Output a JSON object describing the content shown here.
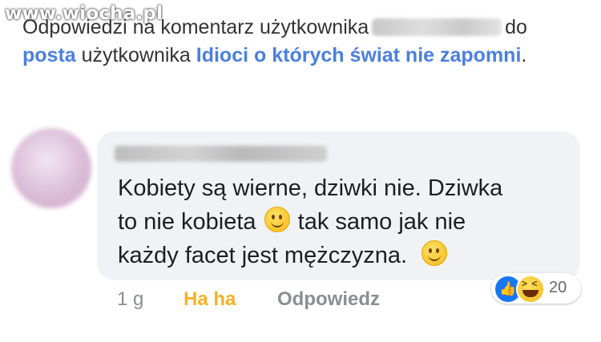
{
  "watermark": "www.wiocha.pl",
  "header": {
    "prefix": "Odpowiedzi na komentarz użytkownika",
    "suffix_after_name": "do",
    "post_link": "posta",
    "middle": "użytkownika",
    "page_link": "Idioci o których świat nie zapomni",
    "end": "."
  },
  "comment": {
    "line1": "Kobiety są wierne,  dziwki nie. Dziwka",
    "line2a": "to nie kobieta",
    "line2b": "tak samo jak nie",
    "line3": "każdy facet jest mężczyzna."
  },
  "actions": {
    "time": "1 g",
    "reaction_label": "Ha ha",
    "reply_label": "Odpowiedz"
  },
  "reactions": {
    "count": "20",
    "icons": [
      "like-icon",
      "haha-icon"
    ],
    "like_color": "#1877f2",
    "haha_color": "#f7b125"
  },
  "colors": {
    "link": "#4a7fe0",
    "bubble": "#f0f2f5",
    "muted": "#8a8d91"
  }
}
